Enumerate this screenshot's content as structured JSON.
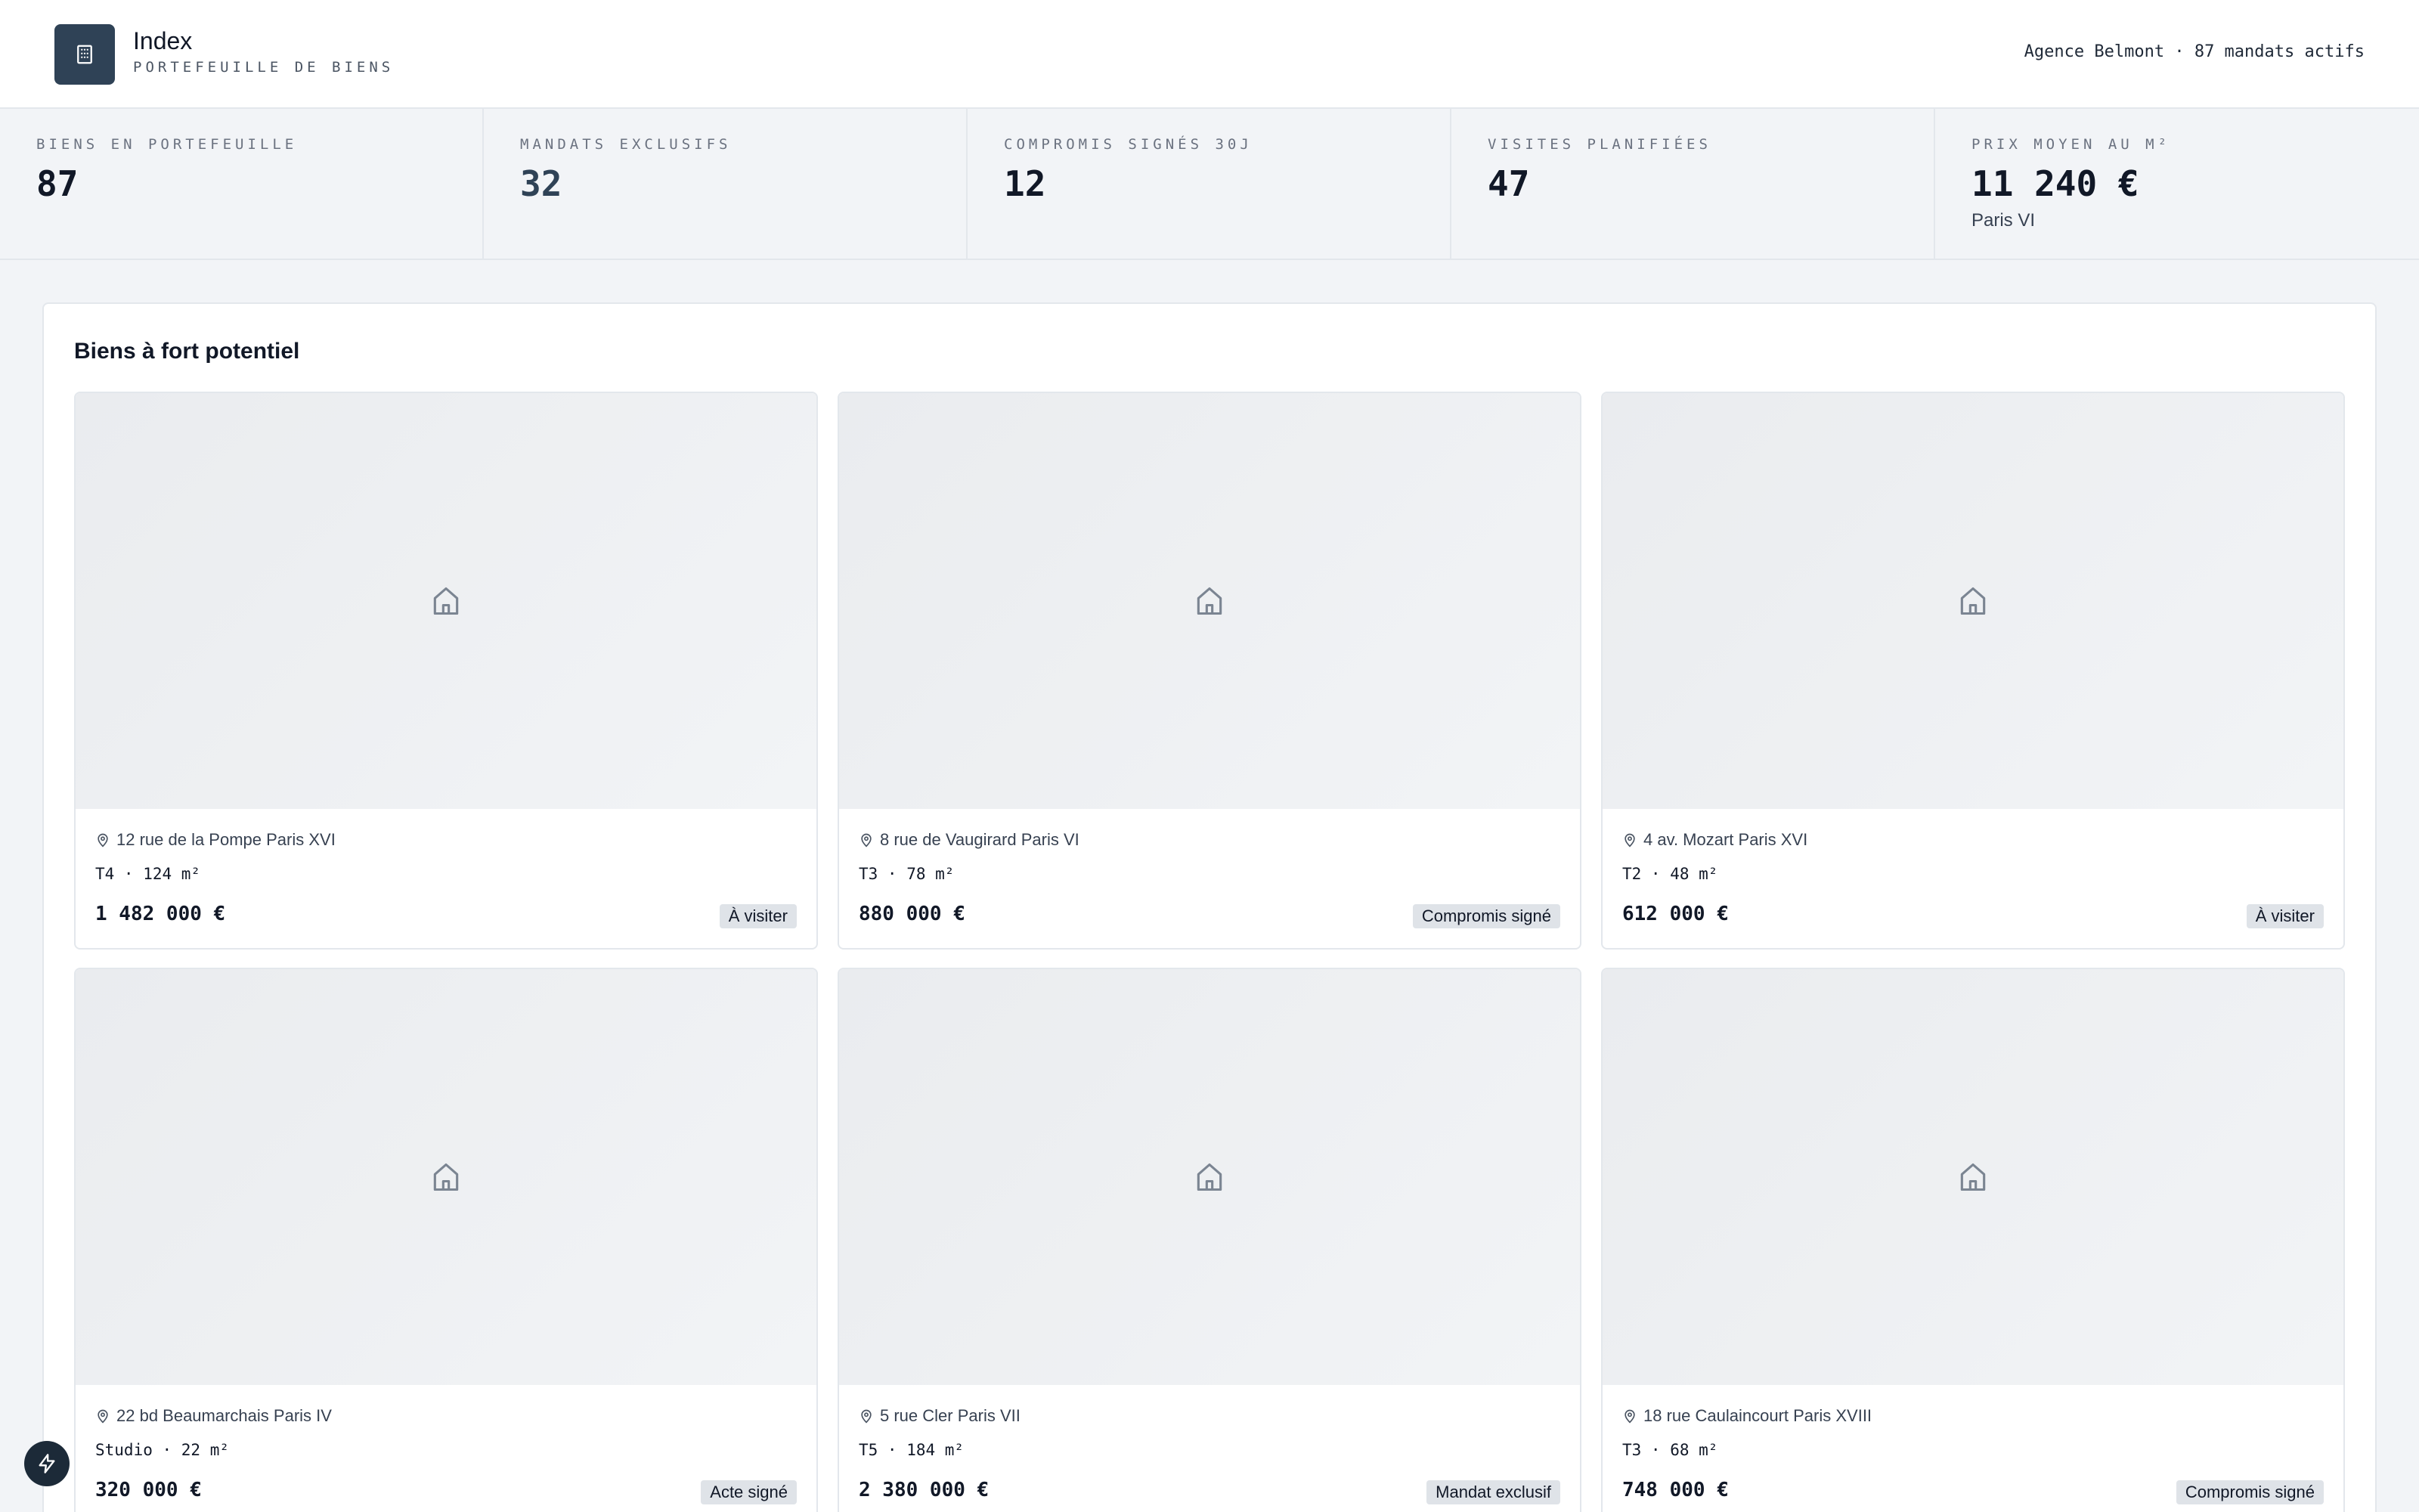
{
  "header": {
    "title": "Index",
    "subtitle": "PORTEFEUILLE DE BIENS",
    "agency": "Agence Belmont · 87 mandats actifs",
    "logo_icon": "building-icon"
  },
  "stats": [
    {
      "label": "BIENS EN PORTEFEUILLE",
      "value": "87",
      "note": ""
    },
    {
      "label": "MANDATS EXCLUSIFS",
      "value": "32",
      "note": ""
    },
    {
      "label": "COMPROMIS SIGNÉS 30J",
      "value": "12",
      "note": ""
    },
    {
      "label": "VISITES PLANIFIÉES",
      "value": "47",
      "note": ""
    },
    {
      "label": "PRIX MOYEN AU M²",
      "value": "11 240 €",
      "note": "Paris VI"
    }
  ],
  "panel": {
    "title": "Biens à fort potentiel",
    "cards": [
      {
        "address": "12 rue de la Pompe Paris XVI",
        "specs": "T4 · 124 m²",
        "price": "1 482 000 €",
        "status": "À visiter"
      },
      {
        "address": "8 rue de Vaugirard Paris VI",
        "specs": "T3 · 78 m²",
        "price": "880 000 €",
        "status": "Compromis signé"
      },
      {
        "address": "4 av. Mozart Paris XVI",
        "specs": "T2 · 48 m²",
        "price": "612 000 €",
        "status": "À visiter"
      },
      {
        "address": "22 bd Beaumarchais Paris IV",
        "specs": "Studio · 22 m²",
        "price": "320 000 €",
        "status": "Acte signé"
      },
      {
        "address": "5 rue Cler Paris VII",
        "specs": "T5 · 184 m²",
        "price": "2 380 000 €",
        "status": "Mandat exclusif"
      },
      {
        "address": "18 rue Caulaincourt Paris XVIII",
        "specs": "T3 · 68 m²",
        "price": "748 000 €",
        "status": "Compromis signé"
      }
    ]
  },
  "colors": {
    "accent": "#2f4256",
    "badge_bg": "#dfe3e8",
    "fab": "#1c2a38"
  },
  "icons": {
    "placeholder": "house-icon",
    "address": "map-pin-icon",
    "fab": "lightning-icon"
  }
}
